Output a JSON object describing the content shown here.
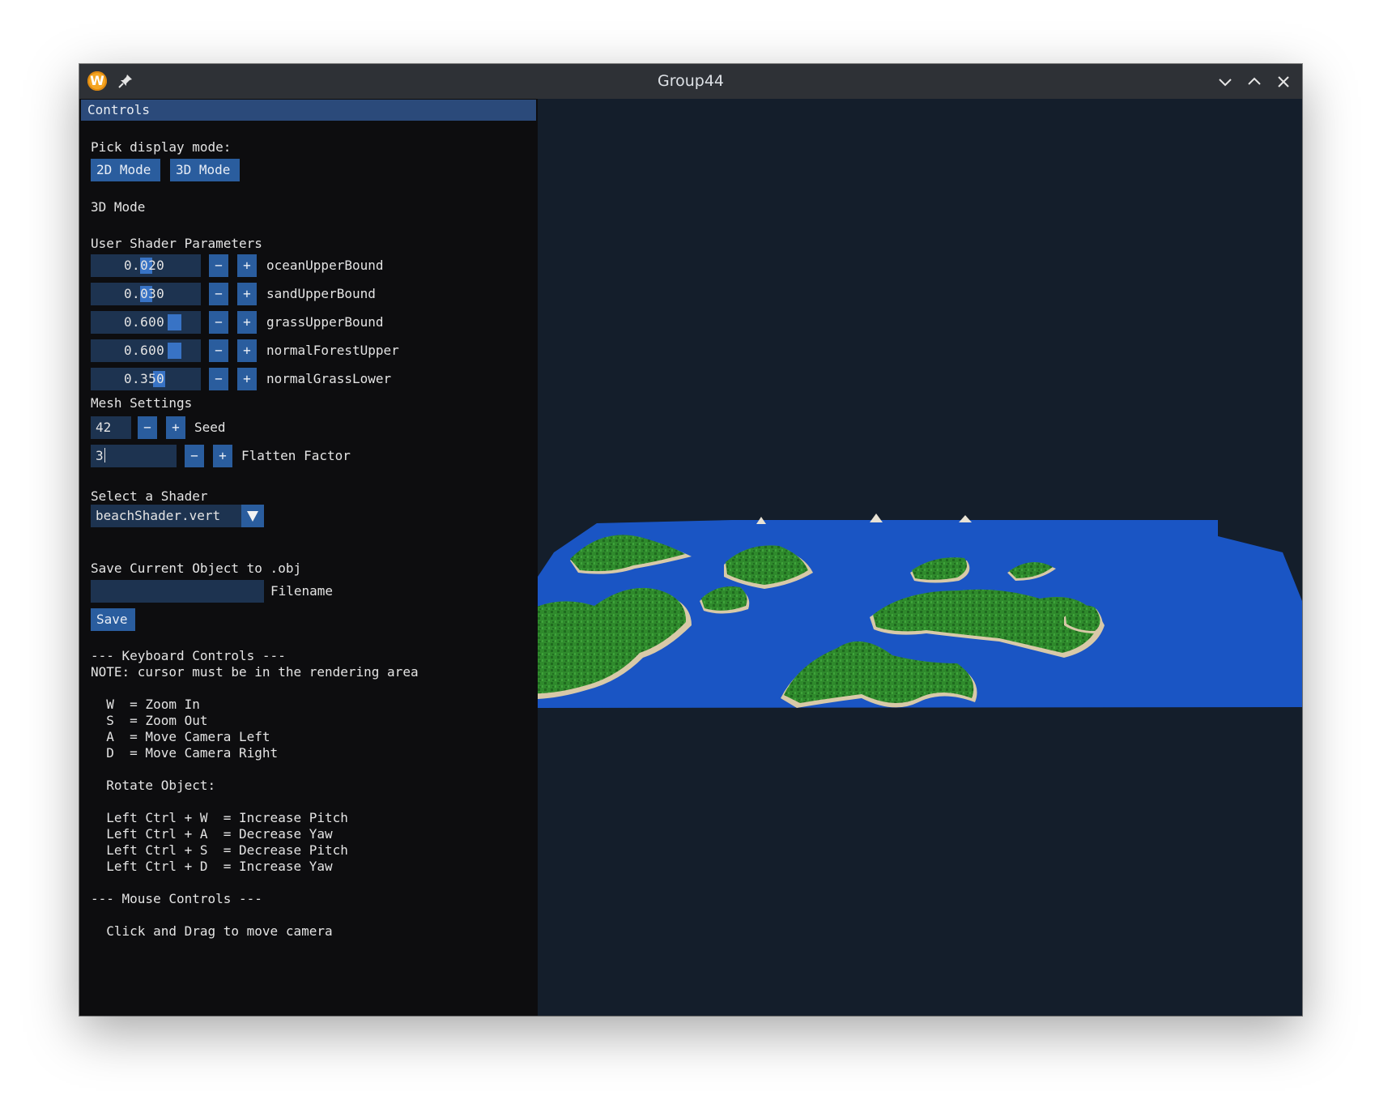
{
  "window": {
    "title": "Group44",
    "app_icon_letter": "W"
  },
  "panel": {
    "header": "Controls",
    "display_mode_label": "Pick display mode:",
    "mode_buttons": [
      "2D Mode",
      "3D Mode"
    ],
    "current_mode": "3D Mode",
    "shader_params_label": "User Shader Parameters",
    "shader_params": [
      {
        "value": "0.020",
        "label": "oceanUpperBound"
      },
      {
        "value": "0.030",
        "label": "sandUpperBound"
      },
      {
        "value": "0.600",
        "label": "grassUpperBound"
      },
      {
        "value": "0.600",
        "label": "normalForestUpper"
      },
      {
        "value": "0.350",
        "label": "normalGrassLower"
      }
    ],
    "mesh_settings_label": "Mesh Settings",
    "seed": {
      "value": "42",
      "label": "Seed"
    },
    "flatten": {
      "value": "3",
      "label": "Flatten Factor"
    },
    "shader_select_label": "Select a Shader",
    "shader_selected": "beachShader.vert",
    "save_label": "Save Current Object to .obj",
    "filename_value": "",
    "filename_label": "Filename",
    "save_button": "Save",
    "stepper_minus": "−",
    "stepper_plus": "+"
  },
  "help": {
    "keyboard_header": "--- Keyboard Controls ---",
    "note": "NOTE: cursor must be in the rendering area",
    "keys": [
      "  W  = Zoom In",
      "  S  = Zoom Out",
      "  A  = Move Camera Left",
      "  D  = Move Camera Right"
    ],
    "rotate_header": "  Rotate Object:",
    "rotate_keys": [
      "  Left Ctrl + W  = Increase Pitch",
      "  Left Ctrl + A  = Decrease Yaw",
      "  Left Ctrl + S  = Decrease Pitch",
      "  Left Ctrl + D  = Increase Yaw"
    ],
    "mouse_header": "--- Mouse Controls ---",
    "mouse_hint": "  Click and Drag to move camera"
  },
  "colors": {
    "panel_bg": "#0d0d0f",
    "header_bg": "#2b4a7a",
    "button": "#2a5d9e",
    "field": "#1d3350",
    "viewport_bg": "#141e2b",
    "ocean": "#1a55c4",
    "sand": "#d8c9a8",
    "grass": "#2f8a2c",
    "forest": "#1f6a1f"
  }
}
